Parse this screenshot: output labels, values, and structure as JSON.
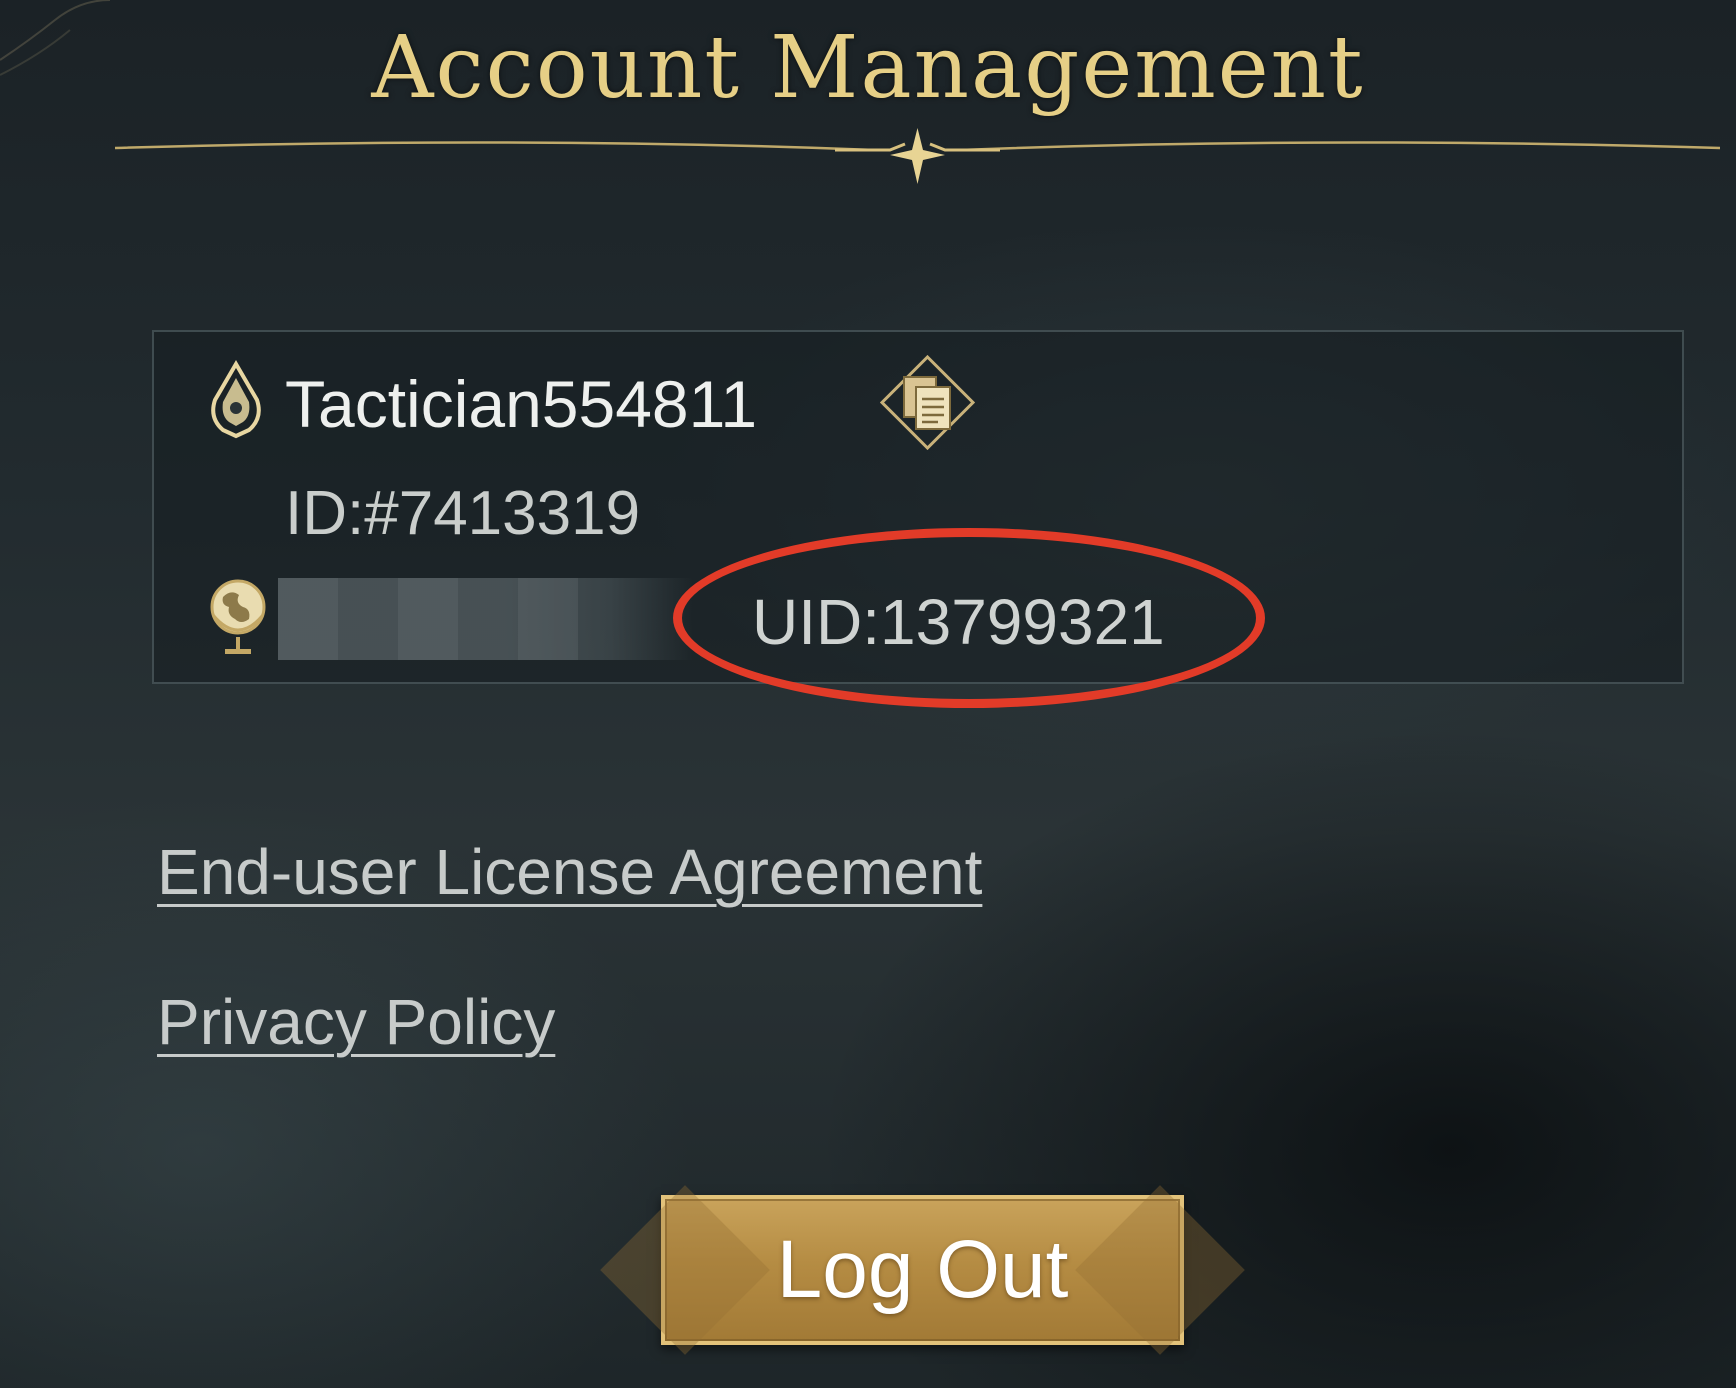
{
  "title": "Account Management",
  "account": {
    "username": "Tactician554811",
    "id": "ID:#7413319",
    "uid": "UID:13799321"
  },
  "links": {
    "eula": "End-user License Agreement",
    "privacy": "Privacy Policy"
  },
  "actions": {
    "logout_label": "Log Out"
  },
  "icons": {
    "user": "hooded-figure-icon",
    "copy": "copy-icon",
    "server": "globe-icon"
  },
  "colors": {
    "title_gold": "#e6cf86",
    "button_gold": "#b58c43",
    "annotation_red": "#e23b28",
    "background": "#222b2f"
  }
}
